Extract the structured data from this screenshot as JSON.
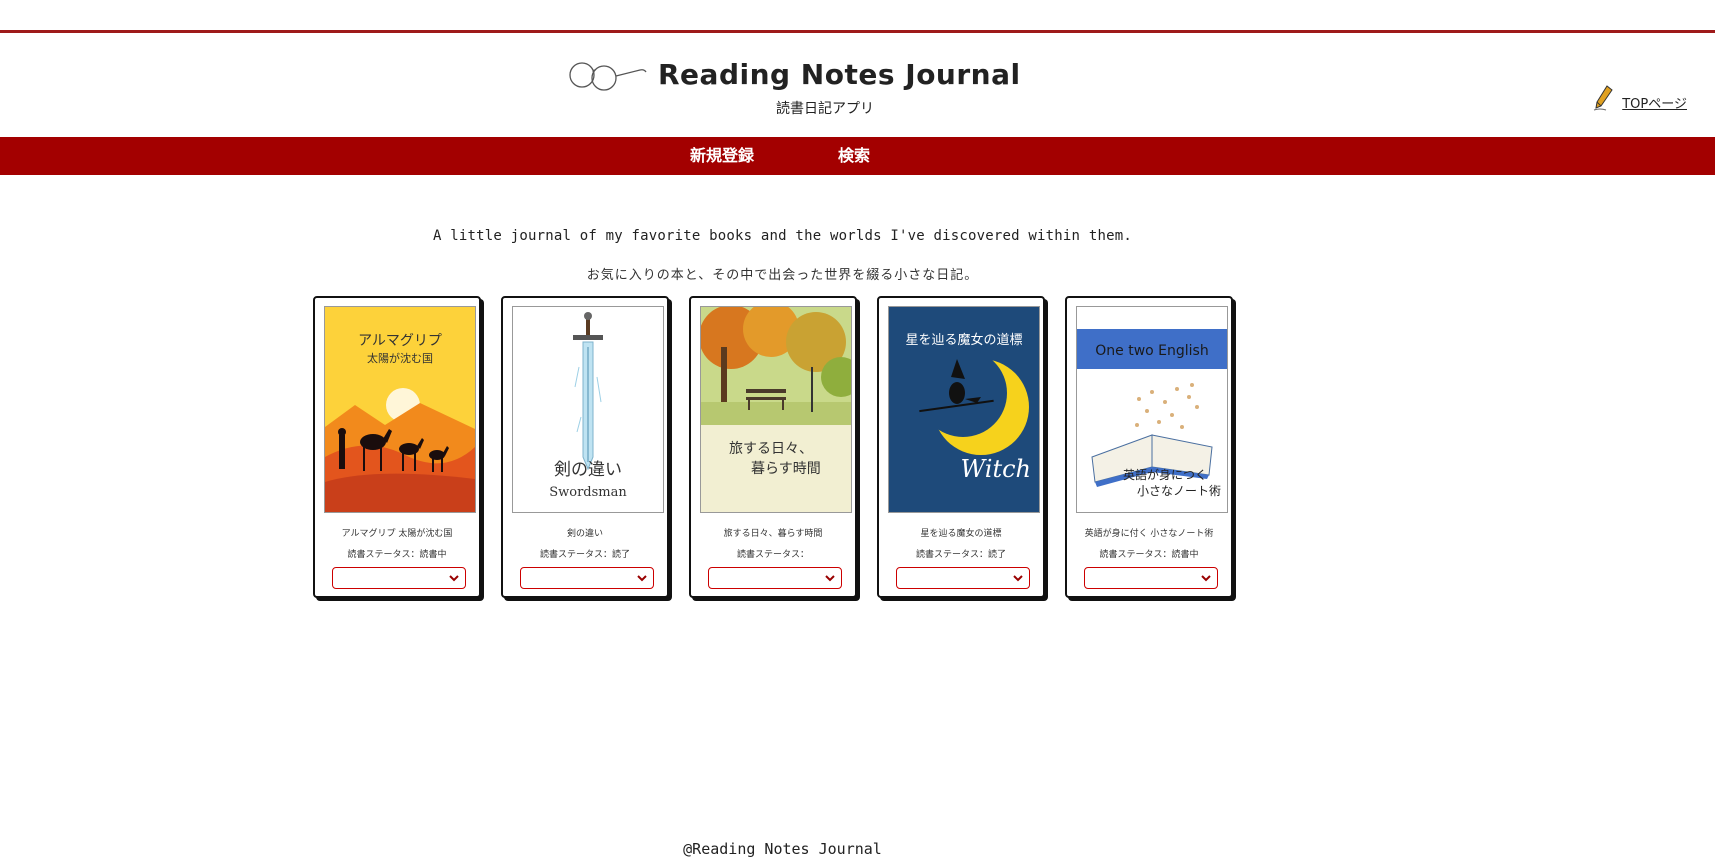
{
  "header": {
    "title": "Reading Notes Journal",
    "subtitle": "読書日記アプリ",
    "top_link": "TOPページ"
  },
  "nav": {
    "items": [
      "新規登録",
      "検索"
    ]
  },
  "intro": {
    "en": "A little journal of my favorite books and the worlds I've discovered within them.",
    "ja": "お気に入りの本と、その中で出会った世界を綴る小さな日記。"
  },
  "books": [
    {
      "cover_line1": "アルマグリプ",
      "cover_line2": "太陽が沈む国",
      "title": "アルマグリプ 太陽が沈む国",
      "status": "読書ステータス：読書中",
      "select_value": ""
    },
    {
      "cover_line1": "剣の違い",
      "cover_line2": "Swordsman",
      "title": "剣の違い",
      "status": "読書ステータス：読了",
      "select_value": ""
    },
    {
      "cover_line1": "旅する日々、",
      "cover_line2": "暮らす時間",
      "title": "旅する日々、暮らす時間",
      "status": "読書ステータス：",
      "select_value": ""
    },
    {
      "cover_line1": "星を辿る魔女の道標",
      "cover_line2": "Witch",
      "title": "星を辿る魔女の道標",
      "status": "読書ステータス：読了",
      "select_value": ""
    },
    {
      "cover_line1": "One two English",
      "cover_line2": "英語が身につく",
      "cover_line3": "小さなノート術",
      "title": "英語が身に付く 小さなノート術",
      "status": "読書ステータス：読書中",
      "select_value": ""
    }
  ],
  "footer": {
    "text": "@Reading Notes Journal"
  },
  "colors": {
    "accent": "#a30000",
    "rule": "#9e1a1a",
    "select_border": "#cc0000"
  },
  "icons": {
    "brand": "glasses-icon",
    "top_link": "pen-icon",
    "select": "chevron-down-icon"
  }
}
